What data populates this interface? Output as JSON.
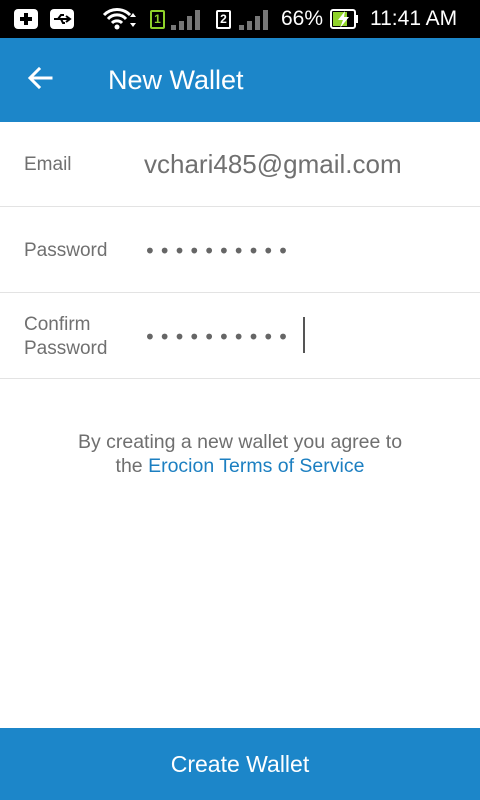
{
  "status_bar": {
    "sim1": "1",
    "sim2": "2",
    "battery": "66%",
    "time": "11:41 AM",
    "icons": [
      "plus-notification-icon",
      "usb-icon",
      "wifi-icon",
      "sim1-icon",
      "signal-icon",
      "sim2-icon",
      "signal-icon",
      "battery-charging-icon"
    ]
  },
  "app_bar": {
    "title": "New Wallet",
    "back_icon": "arrow-left-icon"
  },
  "form": {
    "email": {
      "label": "Email",
      "value": "vchari485@gmail.com"
    },
    "password": {
      "label": "Password",
      "value": "••••••••••"
    },
    "confirm_password": {
      "label_line1": "Confirm",
      "label_line2": "Password",
      "value": "••••••••••"
    }
  },
  "terms": {
    "line1": "By creating a new wallet you agree to",
    "prefix": "the ",
    "link": "Erocion Terms of Service"
  },
  "create_button": {
    "label": "Create Wallet"
  },
  "colors": {
    "primary": "#1c86c9",
    "link": "#1c7fc1",
    "status_bar": "#000000",
    "battery_green": "#8fd22a"
  }
}
